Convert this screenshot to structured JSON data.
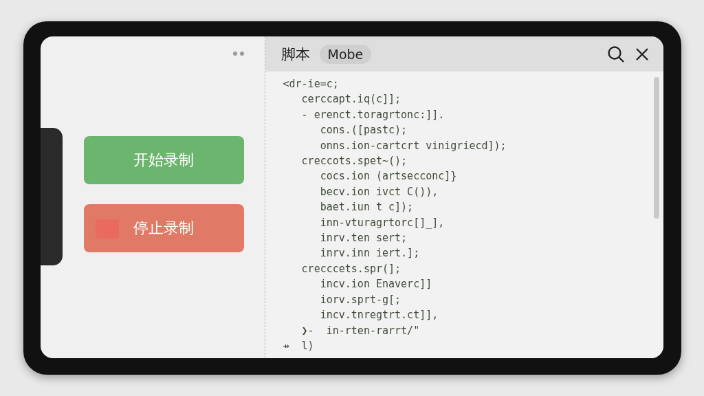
{
  "left_panel": {
    "buttons": [
      {
        "label": "开始录制",
        "kind": "start"
      },
      {
        "label": "停止录制",
        "kind": "stop"
      }
    ]
  },
  "editor": {
    "title": "脚本",
    "tag": "Mobe",
    "lines": [
      "<dr-ie=c;",
      "   cerccapt.iq(c]];",
      "   - erenct.toragrtonc:]].",
      "      cons.([pastc);",
      "      onns.ion-cartcrt vinigriecd]);",
      "   creccots.spet~();",
      "      cocs.ion (artsecconc]}",
      "      becv.ion ivct C()),",
      "      baet.iun t c]);",
      "      inn-vturagrtorc[]_],",
      "      inrv.ten sert;",
      "      inrv.inn iert.];",
      "   crecccets.spr(];",
      "      incv.ion Enaverc]]",
      "      iorv.sprt-g[;",
      "      incv.tnregtrt.ct]],",
      "   ❯-  in-rten-rarrt/\"",
      "⇸  l)"
    ]
  }
}
